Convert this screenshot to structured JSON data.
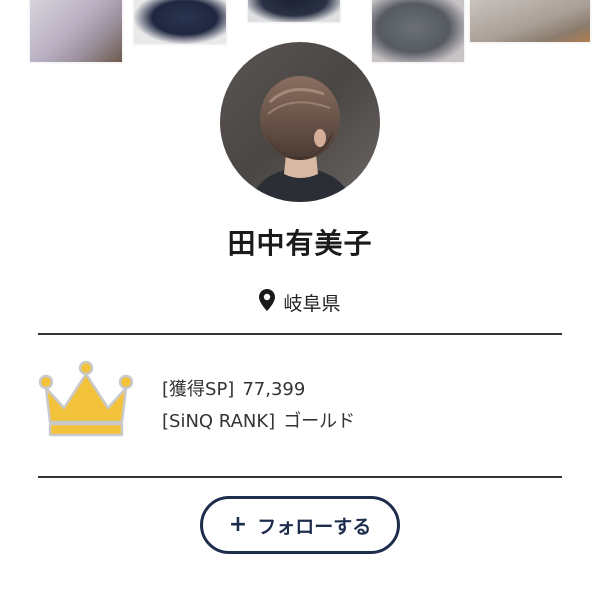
{
  "profile": {
    "name": "田中有美子",
    "location": "岐阜県"
  },
  "rank": {
    "sp_label": "[獲得SP]",
    "sp_value": "77,399",
    "rank_label": "[SiNQ RANK]",
    "rank_value": "ゴールド",
    "crown_icon": "crown-icon",
    "crown_color": "#f2c23a"
  },
  "follow_button": {
    "plus": "+",
    "label": "フォローする",
    "color": "#1f2d4d"
  },
  "icons": {
    "location": "map-pin-icon"
  }
}
